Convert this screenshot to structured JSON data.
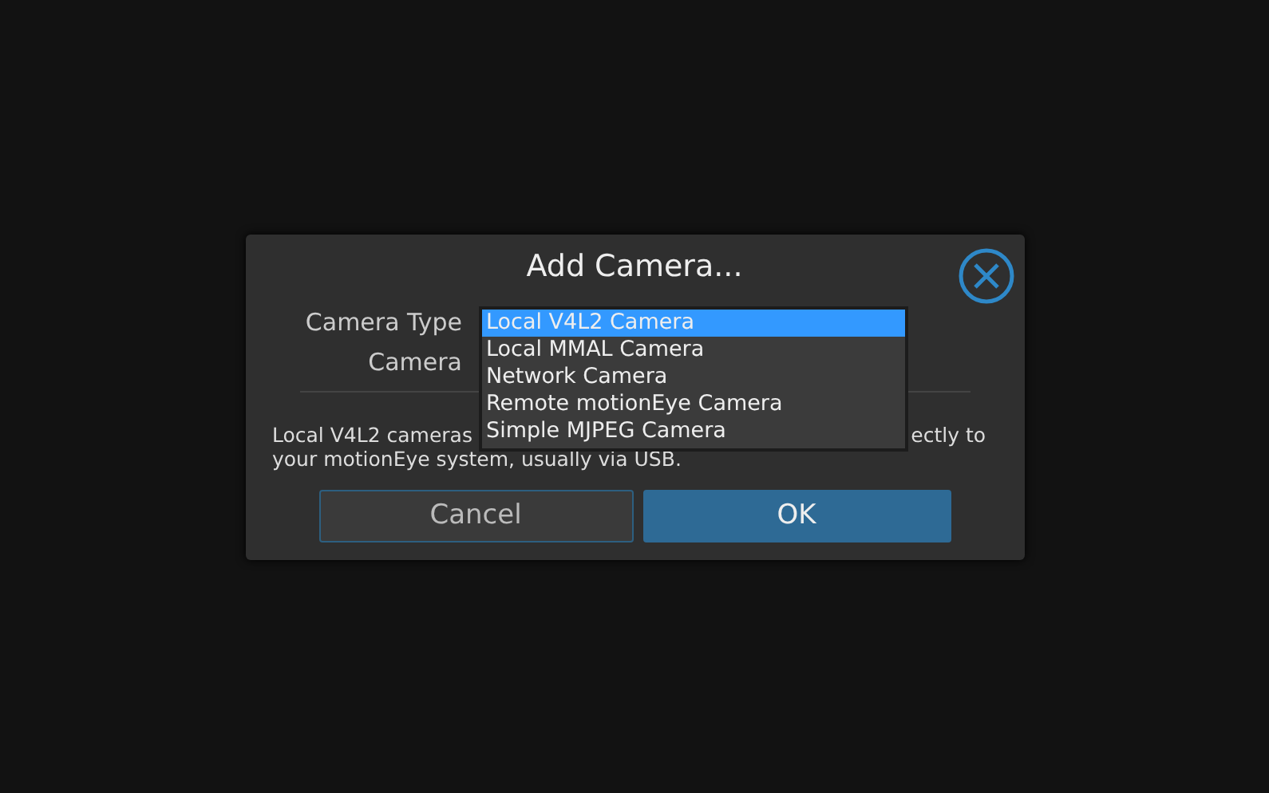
{
  "dialog": {
    "title": "Add Camera...",
    "fields": [
      {
        "label": "Camera Type"
      },
      {
        "label": "Camera"
      }
    ],
    "dropdown": {
      "options": [
        {
          "label": "Local V4L2 Camera",
          "selected": true
        },
        {
          "label": "Local MMAL Camera",
          "selected": false
        },
        {
          "label": "Network Camera",
          "selected": false
        },
        {
          "label": "Remote motionEye Camera",
          "selected": false
        },
        {
          "label": "Simple MJPEG Camera",
          "selected": false
        }
      ]
    },
    "description": {
      "line_1_start": "Local V4L2 cameras",
      "line_1_end": "ectly to",
      "line_2": "your motionEye system, usually via USB."
    },
    "buttons": [
      {
        "label": "Cancel",
        "kind": "secondary"
      },
      {
        "label": "OK",
        "kind": "primary"
      }
    ]
  }
}
